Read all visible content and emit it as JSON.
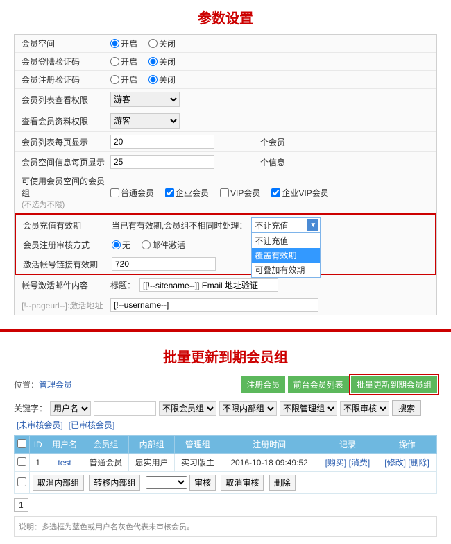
{
  "titles": {
    "section1": "参数设置",
    "section2": "批量更新到期会员组"
  },
  "form": {
    "memberSpace": {
      "label": "会员空间",
      "on": "开启",
      "off": "关闭"
    },
    "loginCaptcha": {
      "label": "会员登陆验证码",
      "on": "开启",
      "off": "关闭"
    },
    "regCaptcha": {
      "label": "会员注册验证码",
      "on": "开启",
      "off": "关闭"
    },
    "listViewPerm": {
      "label": "会员列表查看权限",
      "value": "游客"
    },
    "dataViewPerm": {
      "label": "查看会员资料权限",
      "value": "游客"
    },
    "listPerPage": {
      "label": "会员列表每页显示",
      "value": "20",
      "unit": "个会员"
    },
    "spaceMsgPerPage": {
      "label": "会员空间信息每页显示",
      "value": "25",
      "unit": "个信息"
    },
    "spaceGroups": {
      "label": "可使用会员空间的会员组",
      "sub": "(不选为不限)",
      "options": [
        "普通会员",
        "企业会员",
        "VIP会员",
        "企业VIP会员"
      ]
    },
    "rechargeValidity": {
      "label": "会员充值有效期",
      "prefix": "当已有有效期,会员组不相同时处理：",
      "selected": "不让充值",
      "options": [
        "不让充值",
        "覆盖有效期",
        "可叠加有效期"
      ]
    },
    "regAudit": {
      "label": "会员注册审核方式",
      "optNone": "无",
      "optMail": "邮件激活"
    },
    "activateLinkValidity": {
      "label": "激活帐号链接有效期",
      "value": "720"
    },
    "activateMailContent": {
      "label": "帐号激活邮件内容"
    },
    "subjectLabel": "标题：",
    "subjectValue": "[[!--sitename--]] Email 地址验证",
    "templateText1": "[!--pageurl--]:激活地址",
    "templateText2": "[!--username--]"
  },
  "breadcrumb": {
    "prefix": "位置：",
    "link": "管理会员"
  },
  "topButtons": {
    "reg": "注册会员",
    "frontList": "前台会员列表",
    "batchUpdate": "批量更新到期会员组"
  },
  "filter": {
    "keywordLabel": "关键字：",
    "keywordField": "用户名",
    "memberGroup": "不限会员组",
    "internalGroup": "不限内部组",
    "adminGroup": "不限管理组",
    "audit": "不限审核",
    "searchBtn": "搜索",
    "unaudited": "[未审核会员]",
    "audited": "[已审核会员]"
  },
  "table": {
    "headers": [
      "ID",
      "用户名",
      "会员组",
      "内部组",
      "管理组",
      "注册时间",
      "记录",
      "操作"
    ],
    "row": {
      "id": "1",
      "username": "test",
      "memberGroup": "普通会员",
      "internalGroup": "忠实用户",
      "adminGroup": "实习版主",
      "regTime": "2016-10-18 09:49:52",
      "records": [
        "[购买]",
        "[消费]"
      ],
      "ops": [
        "[修改]",
        "[删除]"
      ]
    },
    "bottomActions": {
      "cancelInternal": "取消内部组",
      "moveInternal": "转移内部组",
      "audit": "审核",
      "cancelAudit": "取消审核",
      "delete": "删除"
    }
  },
  "page": "1",
  "note": {
    "label": "说明：",
    "text": "多选框为蓝色或用户名灰色代表未审核会员。"
  }
}
